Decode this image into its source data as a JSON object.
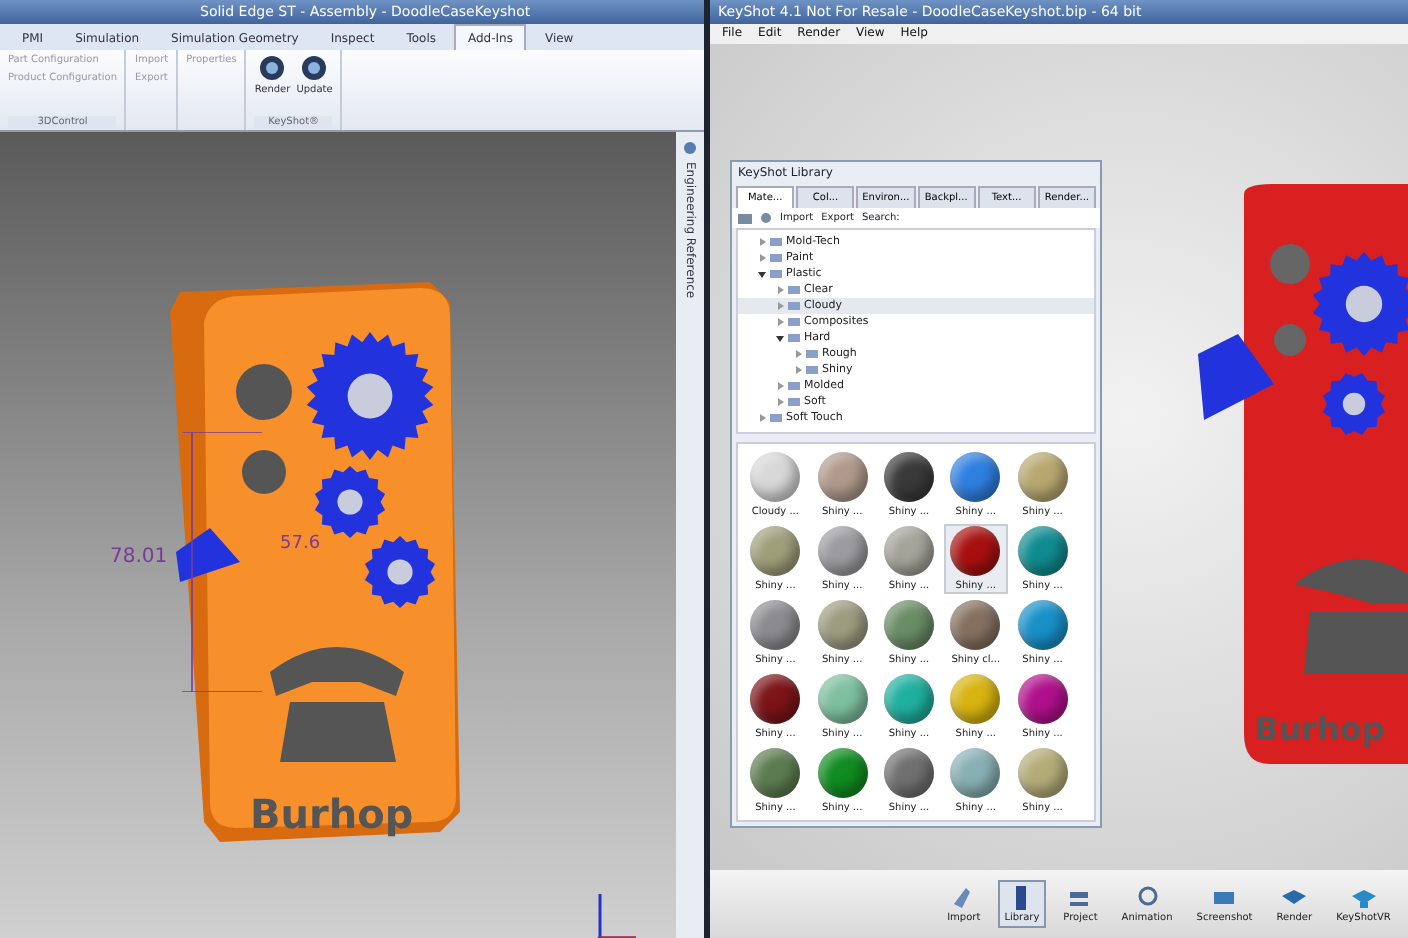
{
  "cad_window": {
    "title": "Solid Edge ST - Assembly - DoodleCaseKeyshot",
    "ribbon_tabs": [
      {
        "label": "PMI",
        "selected": false
      },
      {
        "label": "Simulation",
        "selected": false
      },
      {
        "label": "Simulation Geometry",
        "selected": false
      },
      {
        "label": "Inspect",
        "selected": false
      },
      {
        "label": "Tools",
        "selected": false
      },
      {
        "label": "Add-Ins",
        "selected": true
      },
      {
        "label": "View",
        "selected": false
      }
    ],
    "ribbon_groups": [
      {
        "label": "3DControl",
        "kind": "list",
        "items": [
          "Part Configuration",
          "Product Configuration"
        ]
      },
      {
        "kind": "list",
        "items": [
          "Import",
          "Export"
        ]
      },
      {
        "kind": "list",
        "items": [
          "Properties"
        ]
      },
      {
        "label": "KeyShot®",
        "kind": "icons",
        "items": [
          "Render",
          "Update"
        ]
      }
    ],
    "side_tab": "Engineering Reference",
    "model": {
      "dimension_1": "78.01",
      "dimension_2": "57.6",
      "engraving": "Burhop"
    }
  },
  "keyshot_window": {
    "title": "KeyShot 4.1 Not For Resale - DoodleCaseKeyshot.bip - 64 bit",
    "menu": [
      "File",
      "Edit",
      "Render",
      "View",
      "Help"
    ],
    "model": {
      "engraving": "Burhop"
    },
    "library": {
      "title": "KeyShot Library",
      "tabs": [
        {
          "label": "Mate...",
          "selected": true
        },
        {
          "label": "Col...",
          "selected": false
        },
        {
          "label": "Environ...",
          "selected": false
        },
        {
          "label": "Backpl...",
          "selected": false
        },
        {
          "label": "Text...",
          "selected": false
        },
        {
          "label": "Render...",
          "selected": false
        }
      ],
      "toolbar": [
        "Import",
        "Export",
        "Search:"
      ],
      "tree": [
        {
          "label": "Mold-Tech",
          "expanded": false,
          "selected": false
        },
        {
          "label": "Paint",
          "expanded": false,
          "selected": false
        },
        {
          "label": "Plastic",
          "expanded": true,
          "selected": false,
          "children": [
            {
              "label": "Clear",
              "expanded": false,
              "selected": false
            },
            {
              "label": "Cloudy",
              "expanded": false,
              "selected": true
            },
            {
              "label": "Composites",
              "expanded": false,
              "selected": false
            },
            {
              "label": "Hard",
              "expanded": true,
              "selected": false,
              "children": [
                {
                  "label": "Rough",
                  "expanded": false,
                  "selected": false
                },
                {
                  "label": "Shiny",
                  "expanded": false,
                  "selected": false
                }
              ]
            },
            {
              "label": "Molded",
              "expanded": false,
              "selected": false
            },
            {
              "label": "Soft",
              "expanded": false,
              "selected": false
            }
          ]
        },
        {
          "label": "Soft Touch",
          "expanded": false,
          "selected": false
        }
      ],
      "swatches": [
        {
          "label": "Cloudy ...",
          "color": "#d8d8d8",
          "selected": false
        },
        {
          "label": "Shiny ...",
          "color": "#b09a8c",
          "selected": false
        },
        {
          "label": "Shiny ...",
          "color": "#3a3a3a",
          "selected": false
        },
        {
          "label": "Shiny ...",
          "color": "#2f7fe0",
          "selected": false
        },
        {
          "label": "Shiny ...",
          "color": "#b8a870",
          "selected": false
        },
        {
          "label": "Shiny ...",
          "color": "#9ea07a",
          "selected": false
        },
        {
          "label": "Shiny ...",
          "color": "#9c9ca0",
          "selected": false
        },
        {
          "label": "Shiny ...",
          "color": "#a4a49a",
          "selected": false
        },
        {
          "label": "Shiny ...",
          "color": "#a81010",
          "selected": true
        },
        {
          "label": "Shiny ...",
          "color": "#108c90",
          "selected": false
        },
        {
          "label": "Shiny ...",
          "color": "#8c8c90",
          "selected": false
        },
        {
          "label": "Shiny ...",
          "color": "#9c9c80",
          "selected": false
        },
        {
          "label": "Shiny ...",
          "color": "#6a8c66",
          "selected": false
        },
        {
          "label": "Shiny cl...",
          "color": "#857060",
          "selected": false
        },
        {
          "label": "Shiny ...",
          "color": "#1890c8",
          "selected": false
        },
        {
          "label": "Shiny ...",
          "color": "#7c1418",
          "selected": false
        },
        {
          "label": "Shiny ...",
          "color": "#7ec0a0",
          "selected": false
        },
        {
          "label": "Shiny ...",
          "color": "#20b0a0",
          "selected": false
        },
        {
          "label": "Shiny ...",
          "color": "#d8b410",
          "selected": false
        },
        {
          "label": "Shiny ...",
          "color": "#b0108c",
          "selected": false
        },
        {
          "label": "Shiny ...",
          "color": "#5c7c50",
          "selected": false
        },
        {
          "label": "Shiny ...",
          "color": "#108c20",
          "selected": false
        },
        {
          "label": "Shiny ...",
          "color": "#707070",
          "selected": false
        },
        {
          "label": "Shiny ...",
          "color": "#88b0b4",
          "selected": false
        },
        {
          "label": "Shiny ...",
          "color": "#b4ac78",
          "selected": false
        }
      ]
    },
    "bottom_toolbar": [
      {
        "label": "Import",
        "selected": false
      },
      {
        "label": "Library",
        "selected": true
      },
      {
        "label": "Project",
        "selected": false
      },
      {
        "label": "Animation",
        "selected": false
      },
      {
        "label": "Screenshot",
        "selected": false
      },
      {
        "label": "Render",
        "selected": false
      },
      {
        "label": "KeyShotVR",
        "selected": false
      }
    ]
  }
}
